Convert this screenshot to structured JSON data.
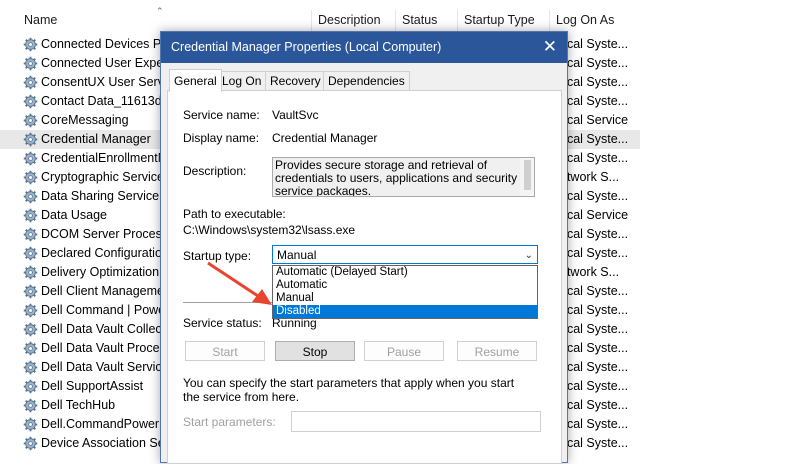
{
  "columns": {
    "name": "Name",
    "description": "Description",
    "status": "Status",
    "startup_type": "Startup Type",
    "log_on_as": "Log On As"
  },
  "services": [
    {
      "name": "Connected Devices Pla",
      "log_on": "ocal Syste..."
    },
    {
      "name": "Connected User Experi",
      "log_on": "ocal Syste..."
    },
    {
      "name": "ConsentUX User Servic",
      "log_on": "ocal Syste..."
    },
    {
      "name": "Contact Data_11613d",
      "log_on": "ocal Syste..."
    },
    {
      "name": "CoreMessaging",
      "log_on": "ocal Service"
    },
    {
      "name": "Credential Manager",
      "log_on": "ocal Syste..."
    },
    {
      "name": "CredentialEnrollmentM",
      "log_on": "ocal Syste..."
    },
    {
      "name": "Cryptographic Services",
      "log_on": "etwork S..."
    },
    {
      "name": "Data Sharing Service",
      "log_on": "ocal Syste..."
    },
    {
      "name": "Data Usage",
      "log_on": "ocal Service"
    },
    {
      "name": "DCOM Server Process I",
      "log_on": "ocal Syste..."
    },
    {
      "name": "Declared Configuration",
      "log_on": "ocal Syste..."
    },
    {
      "name": "Delivery Optimization",
      "log_on": "etwork S..."
    },
    {
      "name": "Dell Client Managemen",
      "log_on": "ocal Syste..."
    },
    {
      "name": "Dell Command | Powe",
      "log_on": "ocal Syste..."
    },
    {
      "name": "Dell Data Vault Collecto",
      "log_on": "ocal Syste..."
    },
    {
      "name": "Dell Data Vault Process",
      "log_on": "ocal Syste..."
    },
    {
      "name": "Dell Data Vault Service",
      "log_on": "ocal Syste..."
    },
    {
      "name": "Dell SupportAssist",
      "log_on": "ocal Syste..."
    },
    {
      "name": "Dell TechHub",
      "log_on": "ocal Syste..."
    },
    {
      "name": "Dell.CommandPowerMa",
      "log_on": "ocal Syste..."
    },
    {
      "name": "Device Association Ser",
      "log_on": "ocal Syste..."
    }
  ],
  "dialog": {
    "title": "Credential Manager Properties (Local Computer)",
    "tabs": [
      "General",
      "Log On",
      "Recovery",
      "Dependencies"
    ],
    "service_name_label": "Service name:",
    "service_name": "VaultSvc",
    "display_name_label": "Display name:",
    "display_name": "Credential Manager",
    "description_label": "Description:",
    "description": "Provides secure storage and retrieval of credentials to users, applications and security service packages.",
    "path_label": "Path to executable:",
    "path": "C:\\Windows\\system32\\lsass.exe",
    "startup_type_label": "Startup type:",
    "startup_type_value": "Manual",
    "startup_options": [
      "Automatic (Delayed Start)",
      "Automatic",
      "Manual",
      "Disabled"
    ],
    "highlighted_option": "Disabled",
    "service_status_label": "Service status:",
    "service_status": "Running",
    "buttons": {
      "start": "Start",
      "stop": "Stop",
      "pause": "Pause",
      "resume": "Resume"
    },
    "hint": "You can specify the start parameters that apply when you start the service from here.",
    "start_parameters_label": "Start parameters:"
  },
  "colors": {
    "titlebar": "#2b579a",
    "selection": "#0078d7",
    "arrow": "#e8442e"
  }
}
